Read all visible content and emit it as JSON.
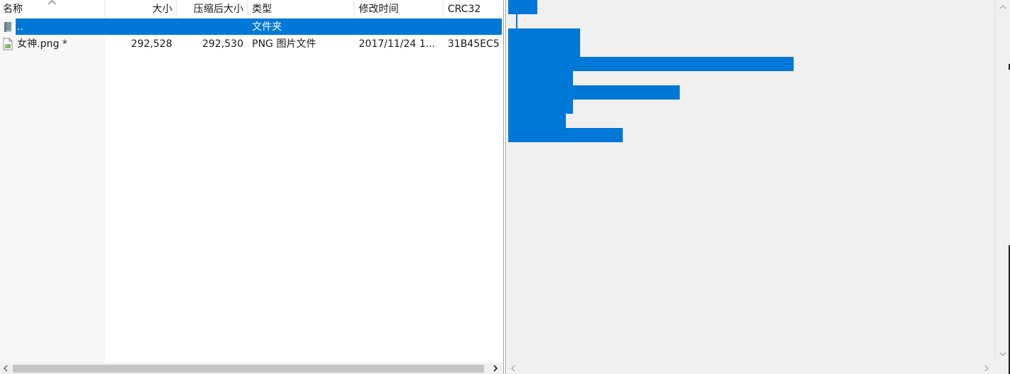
{
  "columns": {
    "name": "名称",
    "size": "大小",
    "packed": "压缩后大小",
    "type": "类型",
    "modified": "修改时间",
    "crc": "CRC32"
  },
  "rows": [
    {
      "icon": "folder-up-icon",
      "name": "..",
      "size": "",
      "packed": "",
      "type": "文件夹",
      "modified": "",
      "crc": "",
      "selected": true
    },
    {
      "icon": "image-file-icon",
      "name": "女神.png *",
      "size": "292,528",
      "packed": "292,530",
      "type": "PNG 图片文件",
      "modified": "2017/11/24 1...",
      "crc": "31B45EC5",
      "selected": false
    }
  ],
  "tree": {
    "highlight_color": "#0078d7",
    "item_count": 10
  },
  "colors": {
    "selection": "#0078d7",
    "pane_background": "#f0f0f0"
  }
}
